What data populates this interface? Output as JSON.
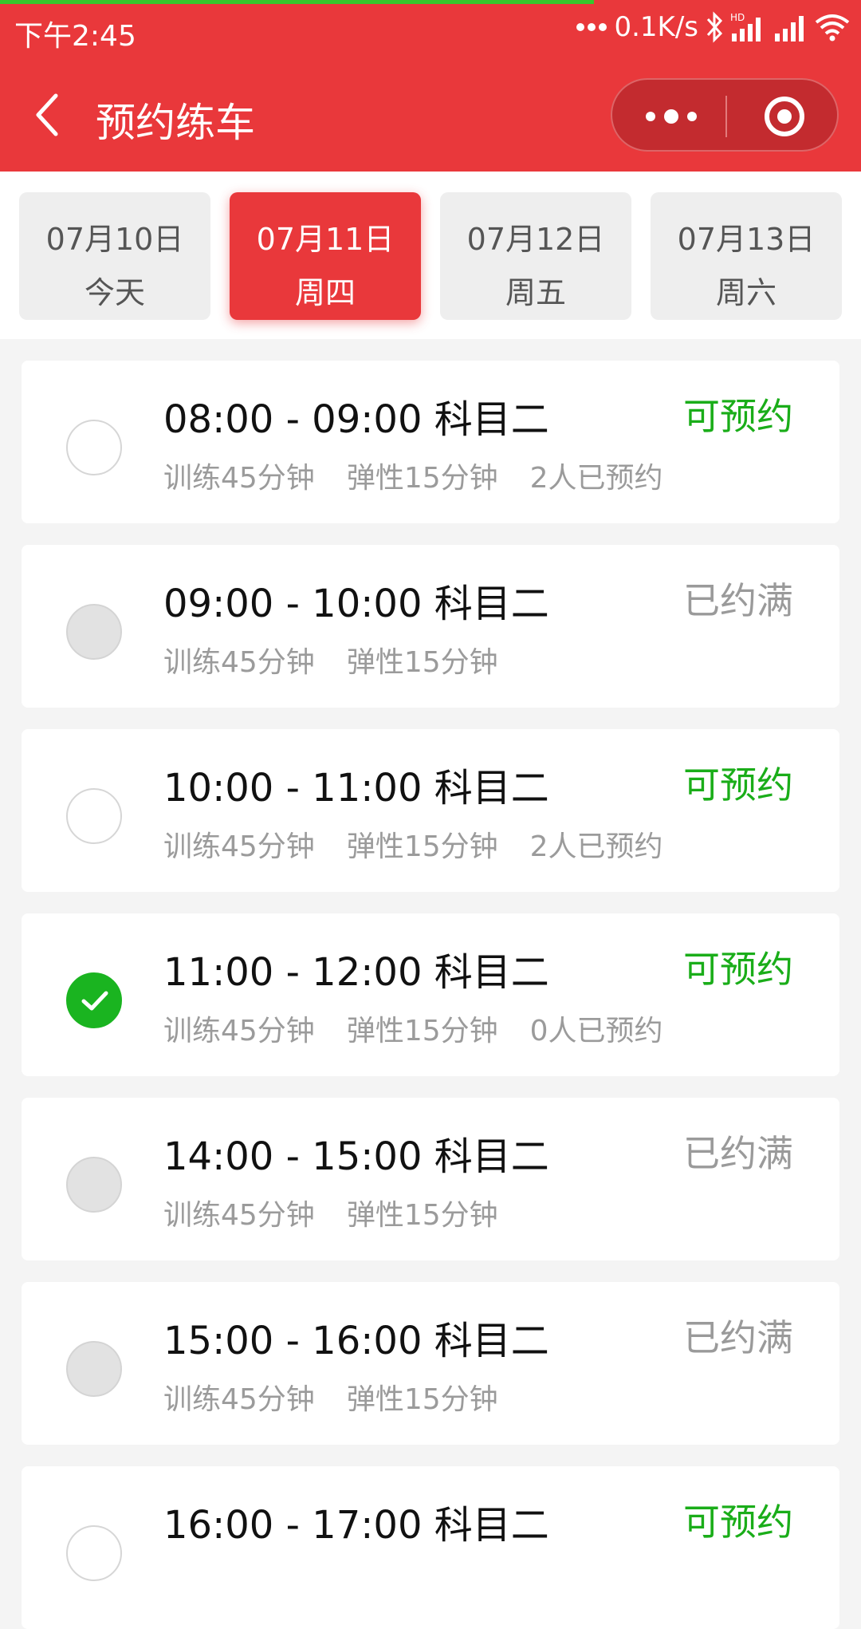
{
  "status_bar": {
    "time": "下午2:45",
    "speed": "0.1K/s"
  },
  "nav": {
    "title": "预约练车",
    "icons": [
      "back-chevron-icon",
      "more-dots-icon",
      "close-target-icon"
    ]
  },
  "colors": {
    "brand": "#e9383b",
    "available": "#1aad19",
    "full": "#9a9a9a"
  },
  "dates": [
    {
      "date": "07月10日",
      "weekday": "今天",
      "active": false
    },
    {
      "date": "07月11日",
      "weekday": "周四",
      "active": true
    },
    {
      "date": "07月12日",
      "weekday": "周五",
      "active": false
    },
    {
      "date": "07月13日",
      "weekday": "周六",
      "active": false
    }
  ],
  "slots": [
    {
      "time": "08:00 - 09:00 科目二",
      "status": "可预约",
      "training": "训练45分钟",
      "buffer": "弹性15分钟",
      "booked": "2人已预约",
      "state": "empty"
    },
    {
      "time": "09:00 - 10:00 科目二",
      "status": "已约满",
      "training": "训练45分钟",
      "buffer": "弹性15分钟",
      "booked": "",
      "state": "disabled"
    },
    {
      "time": "10:00 - 11:00 科目二",
      "status": "可预约",
      "training": "训练45分钟",
      "buffer": "弹性15分钟",
      "booked": "2人已预约",
      "state": "empty"
    },
    {
      "time": "11:00 - 12:00 科目二",
      "status": "可预约",
      "training": "训练45分钟",
      "buffer": "弹性15分钟",
      "booked": "0人已预约",
      "state": "checked"
    },
    {
      "time": "14:00 - 15:00 科目二",
      "status": "已约满",
      "training": "训练45分钟",
      "buffer": "弹性15分钟",
      "booked": "",
      "state": "disabled"
    },
    {
      "time": "15:00 - 16:00 科目二",
      "status": "已约满",
      "training": "训练45分钟",
      "buffer": "弹性15分钟",
      "booked": "",
      "state": "disabled"
    },
    {
      "time": "16:00 - 17:00 科目二",
      "status": "可预约",
      "training": "",
      "buffer": "",
      "booked": "",
      "state": "empty"
    }
  ]
}
